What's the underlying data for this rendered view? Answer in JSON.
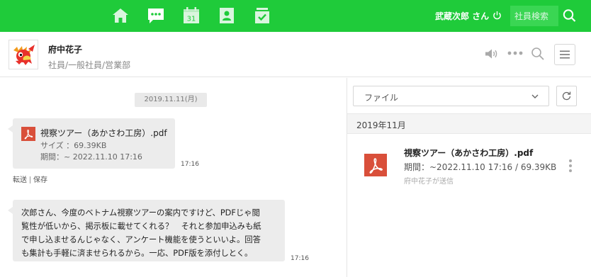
{
  "topbar": {
    "bg_color": "#1fcb3a",
    "nav_icons": [
      "home-icon",
      "chat-icon",
      "calendar-icon",
      "contacts-icon",
      "tasks-icon"
    ],
    "calendar_day": "31",
    "user_label": "武蔵次郎 さん",
    "search_placeholder": "社員検索"
  },
  "conversation": {
    "name": "府中花子",
    "department": "社員/一般社員/営業部"
  },
  "chat": {
    "date_divider": "2019.11.11(月)",
    "file_message": {
      "title": "視察ツアー（あかさわ工房）.pdf",
      "size": "サイズ ：69.39KB",
      "period": "期間：~ 2022.11.10 17:16",
      "time": "17:16",
      "action_forward": "転送",
      "action_save": "保存"
    },
    "text_message": {
      "lines": [
        "次郎さん、今度のベトナム視察ツアーの案内ですけど、PDFじゃ閲",
        "覧性が低いから、掲示板に載せてくれる？　それと参加申込みも紙",
        "で申し込ませるんじゃなく、アンケート機能を使うといいよ。回答",
        "も集計も手軽に済ませられるから。一応、PDF版を添付しとく。"
      ],
      "time": "17:16"
    }
  },
  "file_panel": {
    "filter_value": "ファイル",
    "month": "2019年11月",
    "file": {
      "title": "視察ツアー（あかさわ工房）.pdf",
      "meta": "期間：~2022.11.10 17:16 / 69.39KB",
      "sender": "府中花子が送信"
    }
  }
}
